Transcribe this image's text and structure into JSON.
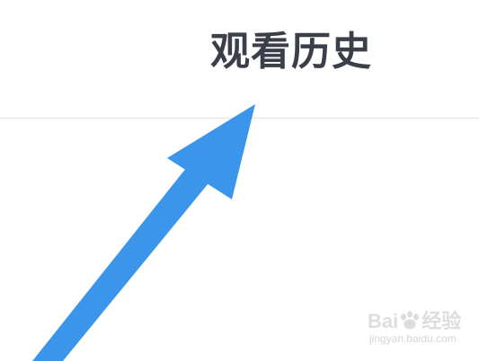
{
  "header": {
    "title": "观看历史"
  },
  "watermark": {
    "brand_left": "Bai",
    "brand_right": "经验",
    "site": "jingyan.baidu.com"
  },
  "colors": {
    "title_text": "#3a3f4a",
    "arrow": "#3b95ea",
    "divider": "#e6e6e6"
  },
  "icons": {
    "annotation": "arrow-up-right-icon",
    "watermark": "paw-icon"
  }
}
